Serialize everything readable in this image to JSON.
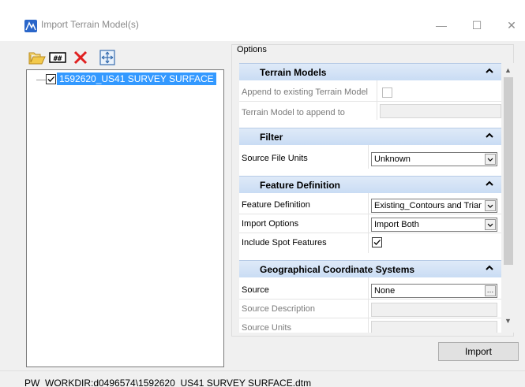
{
  "window": {
    "title": "Import Terrain Model(s)",
    "minimize_glyph": "—",
    "maximize_glyph": "☐",
    "close_glyph": "✕"
  },
  "toolbar": {
    "icons": [
      "open-folder-icon",
      "grid-icon",
      "delete-icon",
      "zoom-extents-icon"
    ]
  },
  "tree": {
    "items": [
      {
        "label": "1592620_US41 SURVEY SURFACE",
        "checked": true
      }
    ]
  },
  "options": {
    "group_label": "Options",
    "sections": {
      "terrain_models": {
        "title": "Terrain Models",
        "append_label": "Append to existing Terrain Model",
        "append_to_label": "Terrain Model to append to"
      },
      "filter": {
        "title": "Filter",
        "source_units_label": "Source File Units",
        "source_units_value": "Unknown"
      },
      "feature_definition": {
        "title": "Feature Definition",
        "feature_def_label": "Feature Definition",
        "feature_def_value": "Existing_Contours and Triang",
        "import_options_label": "Import Options",
        "import_options_value": "Import Both",
        "spot_features_label": "Include Spot Features",
        "spot_features_checked": true
      },
      "gcs": {
        "title": "Geographical Coordinate Systems",
        "source_label": "Source",
        "source_value": "None",
        "source_desc_label": "Source Description",
        "source_units_label": "Source Units"
      }
    }
  },
  "actions": {
    "import_label": "Import"
  },
  "status": {
    "path": "PW_WORKDIR:d0496574\\1592620_US41 SURVEY SURFACE.dtm"
  },
  "colors": {
    "selection": "#3399ff",
    "section_header": "#c9dcf4",
    "app_icon": "#2a66c9"
  }
}
